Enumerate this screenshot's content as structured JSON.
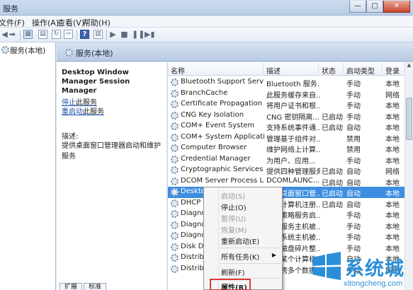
{
  "window": {
    "title": "服务",
    "min": "—",
    "max": "□",
    "close": "✕"
  },
  "menu": [
    "文件(F)",
    "操作(A)",
    "查看(V)",
    "帮助(H)"
  ],
  "tree": {
    "root": "服务(本地)"
  },
  "pane_header": "服务(本地)",
  "detail": {
    "name": "Desktop Window Manager Session Manager",
    "stop_link": "停止",
    "stop_suffix": "此服务",
    "restart_link": "重启动",
    "restart_suffix": "此服务",
    "desc_label": "描述:",
    "desc_text": "提供桌面窗口管理器启动和维护服务"
  },
  "columns": {
    "name": "名称",
    "desc": "描述",
    "status": "状态",
    "startup": "启动类型",
    "logon": "登录"
  },
  "rows": [
    {
      "name": "Bluetooth Support Service",
      "desc": "Bluetooth 服务...",
      "status": "",
      "startup": "手动",
      "logon": "本地"
    },
    {
      "name": "BranchCache",
      "desc": "此服务缓存来自...",
      "status": "",
      "startup": "手动",
      "logon": "网络"
    },
    {
      "name": "Certificate Propagation",
      "desc": "将用户证书和根...",
      "status": "",
      "startup": "手动",
      "logon": "本地"
    },
    {
      "name": "CNG Key Isolation",
      "desc": "CNG 密钥隔离...",
      "status": "已启动",
      "startup": "手动",
      "logon": "本地"
    },
    {
      "name": "COM+ Event System",
      "desc": "支持系统事件通...",
      "status": "已启动",
      "startup": "自动",
      "logon": "本地"
    },
    {
      "name": "COM+ System Application",
      "desc": "管理基于组件对...",
      "status": "",
      "startup": "禁用",
      "logon": "本地"
    },
    {
      "name": "Computer Browser",
      "desc": "维护网络上计算...",
      "status": "",
      "startup": "禁用",
      "logon": "本地"
    },
    {
      "name": "Credential Manager",
      "desc": "为用户、应用...",
      "status": "",
      "startup": "手动",
      "logon": "本地"
    },
    {
      "name": "Cryptographic Services",
      "desc": "提供四种管理服务",
      "status": "已启动",
      "startup": "自动",
      "logon": "网络"
    },
    {
      "name": "DCOM Server Process La...",
      "desc": "DCOMLAUNC...",
      "status": "已启动",
      "startup": "自动",
      "logon": "本地"
    },
    {
      "name": "Desktop Window Manager...",
      "desc": "提供桌面窗口管...",
      "status": "已启动",
      "startup": "自动",
      "logon": "本地"
    },
    {
      "name": "DHCP Client",
      "desc": "为此计算机注册...",
      "status": "已启动",
      "startup": "自动",
      "logon": "本地"
    },
    {
      "name": "Diagnostic Policy Service",
      "desc": "诊断策略服务启...",
      "status": "",
      "startup": "手动",
      "logon": "本地"
    },
    {
      "name": "Diagnostic Service Host",
      "desc": "诊断服务主机被...",
      "status": "",
      "startup": "手动",
      "logon": "本地"
    },
    {
      "name": "Diagnostic System Host",
      "desc": "诊断系统主机被...",
      "status": "",
      "startup": "手动",
      "logon": "本地"
    },
    {
      "name": "Disk Defragmenter",
      "desc": "提供磁盘碎片整...",
      "status": "",
      "startup": "手动",
      "logon": "本地"
    },
    {
      "name": "Distributed Link Tracking",
      "desc": "维护某个计算机...",
      "status": "",
      "startup": "自动",
      "logon": "本地"
    },
    {
      "name": "Distributed Transaction",
      "desc": "协调跨多个数据...",
      "status": "",
      "startup": "手动",
      "logon": "网络"
    }
  ],
  "context_menu": {
    "start": "启动(S)",
    "stop": "停止(O)",
    "pause": "暂停(U)",
    "resume": "恢复(M)",
    "restart": "重新启动(E)",
    "all_tasks": "所有任务(K)",
    "refresh": "刷新(F)",
    "properties": "属性(R)"
  },
  "bottom_tabs": [
    "扩展",
    "标准"
  ],
  "watermark": {
    "brand": "系统城",
    "url": "xitongcheng.com"
  },
  "colors": {
    "selection": "#3d8ee0",
    "highlight_box": "#e03a3a",
    "watermark": "#2a8fd8"
  }
}
